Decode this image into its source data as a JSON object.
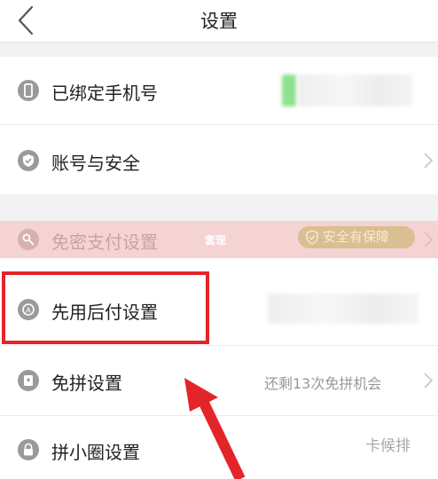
{
  "header": {
    "title": "设置"
  },
  "settings": [
    {
      "label": "已绑定手机号"
    },
    {
      "label": "账号与安全"
    },
    {
      "label": "免密支付设置",
      "overlay": "套现",
      "badge": "安全有保障"
    },
    {
      "label": "先用后付设置"
    },
    {
      "label": "免拼设置",
      "value": "还剩13次免拼机会"
    },
    {
      "label": "拼小圈设置"
    }
  ],
  "watermark": "卡候排",
  "colors": {
    "highlight_row": "#f6d3d3",
    "annotation_box": "#e3252a",
    "annotation_arrow": "#e3252a",
    "badge": "#d9bf91",
    "phone_blur_accent": "#8fe08f"
  },
  "annotations": {
    "highlighted_item": "先用后付设置",
    "arrow_points_to": "先用后付设置"
  }
}
